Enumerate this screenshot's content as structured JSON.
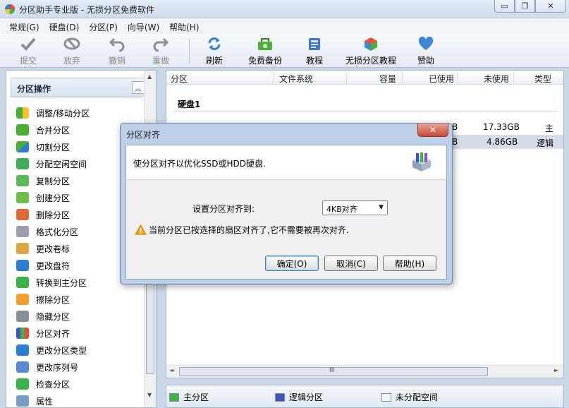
{
  "window": {
    "title": "分区助手专业版 - 无损分区免费软件",
    "controls": {
      "minimize": "▭",
      "restore": "❐",
      "close": "✕"
    }
  },
  "menu": [
    "常规(G)",
    "硬盘(D)",
    "分区(P)",
    "向导(W)",
    "帮助(H)"
  ],
  "toolbar": {
    "commit": "提交",
    "discard": "放弃",
    "undo": "撤销",
    "redo": "重做",
    "refresh": "刷新",
    "backup": "免费备份",
    "tutorial": "教程",
    "lossless_tutorial": "无损分区教程",
    "donate": "赞助"
  },
  "left_panel": {
    "header": "分区操作",
    "collapse_glyph": "︽",
    "items": [
      "调整/移动分区",
      "合并分区",
      "切割分区",
      "分配空闲空间",
      "复制分区",
      "创建分区",
      "删除分区",
      "格式化分区",
      "更改卷标",
      "更改盘符",
      "转换到主分区",
      "擦除分区",
      "隐藏分区",
      "分区对齐",
      "更改分区类型",
      "更改序列号",
      "检查分区",
      "属性"
    ]
  },
  "table": {
    "columns": [
      "分区",
      "文件系统",
      "容量",
      "已使用",
      "未使用",
      "类型"
    ],
    "disk_label": "硬盘1",
    "rows": [
      {
        "used_tail": "B",
        "unused": "17.33GB",
        "type": "主"
      },
      {
        "used_tail": "B",
        "unused": "4.86GB",
        "type": "逻辑"
      }
    ],
    "hscroll_grip": "III"
  },
  "legend": {
    "primary": "主分区",
    "logical": "逻辑分区",
    "unallocated": "未分配空间"
  },
  "dialog": {
    "title": "分区对齐",
    "close": "✕",
    "description": "使分区对齐以优化SSD或HDD硬盘.",
    "set_label": "设置分区对齐到:",
    "select_value": "4KB对齐",
    "warning": "当前分区已按选择的扇区对齐了,它不需要被再次对齐.",
    "ok": "确定(O)",
    "cancel": "取消(C)",
    "help": "帮助(H)"
  },
  "colors": {
    "primary_swatch": "#3db34a",
    "logical_swatch": "#3f52c2",
    "unallocated_swatch": "#f4f4f4",
    "accent": "#bcd0e8"
  }
}
